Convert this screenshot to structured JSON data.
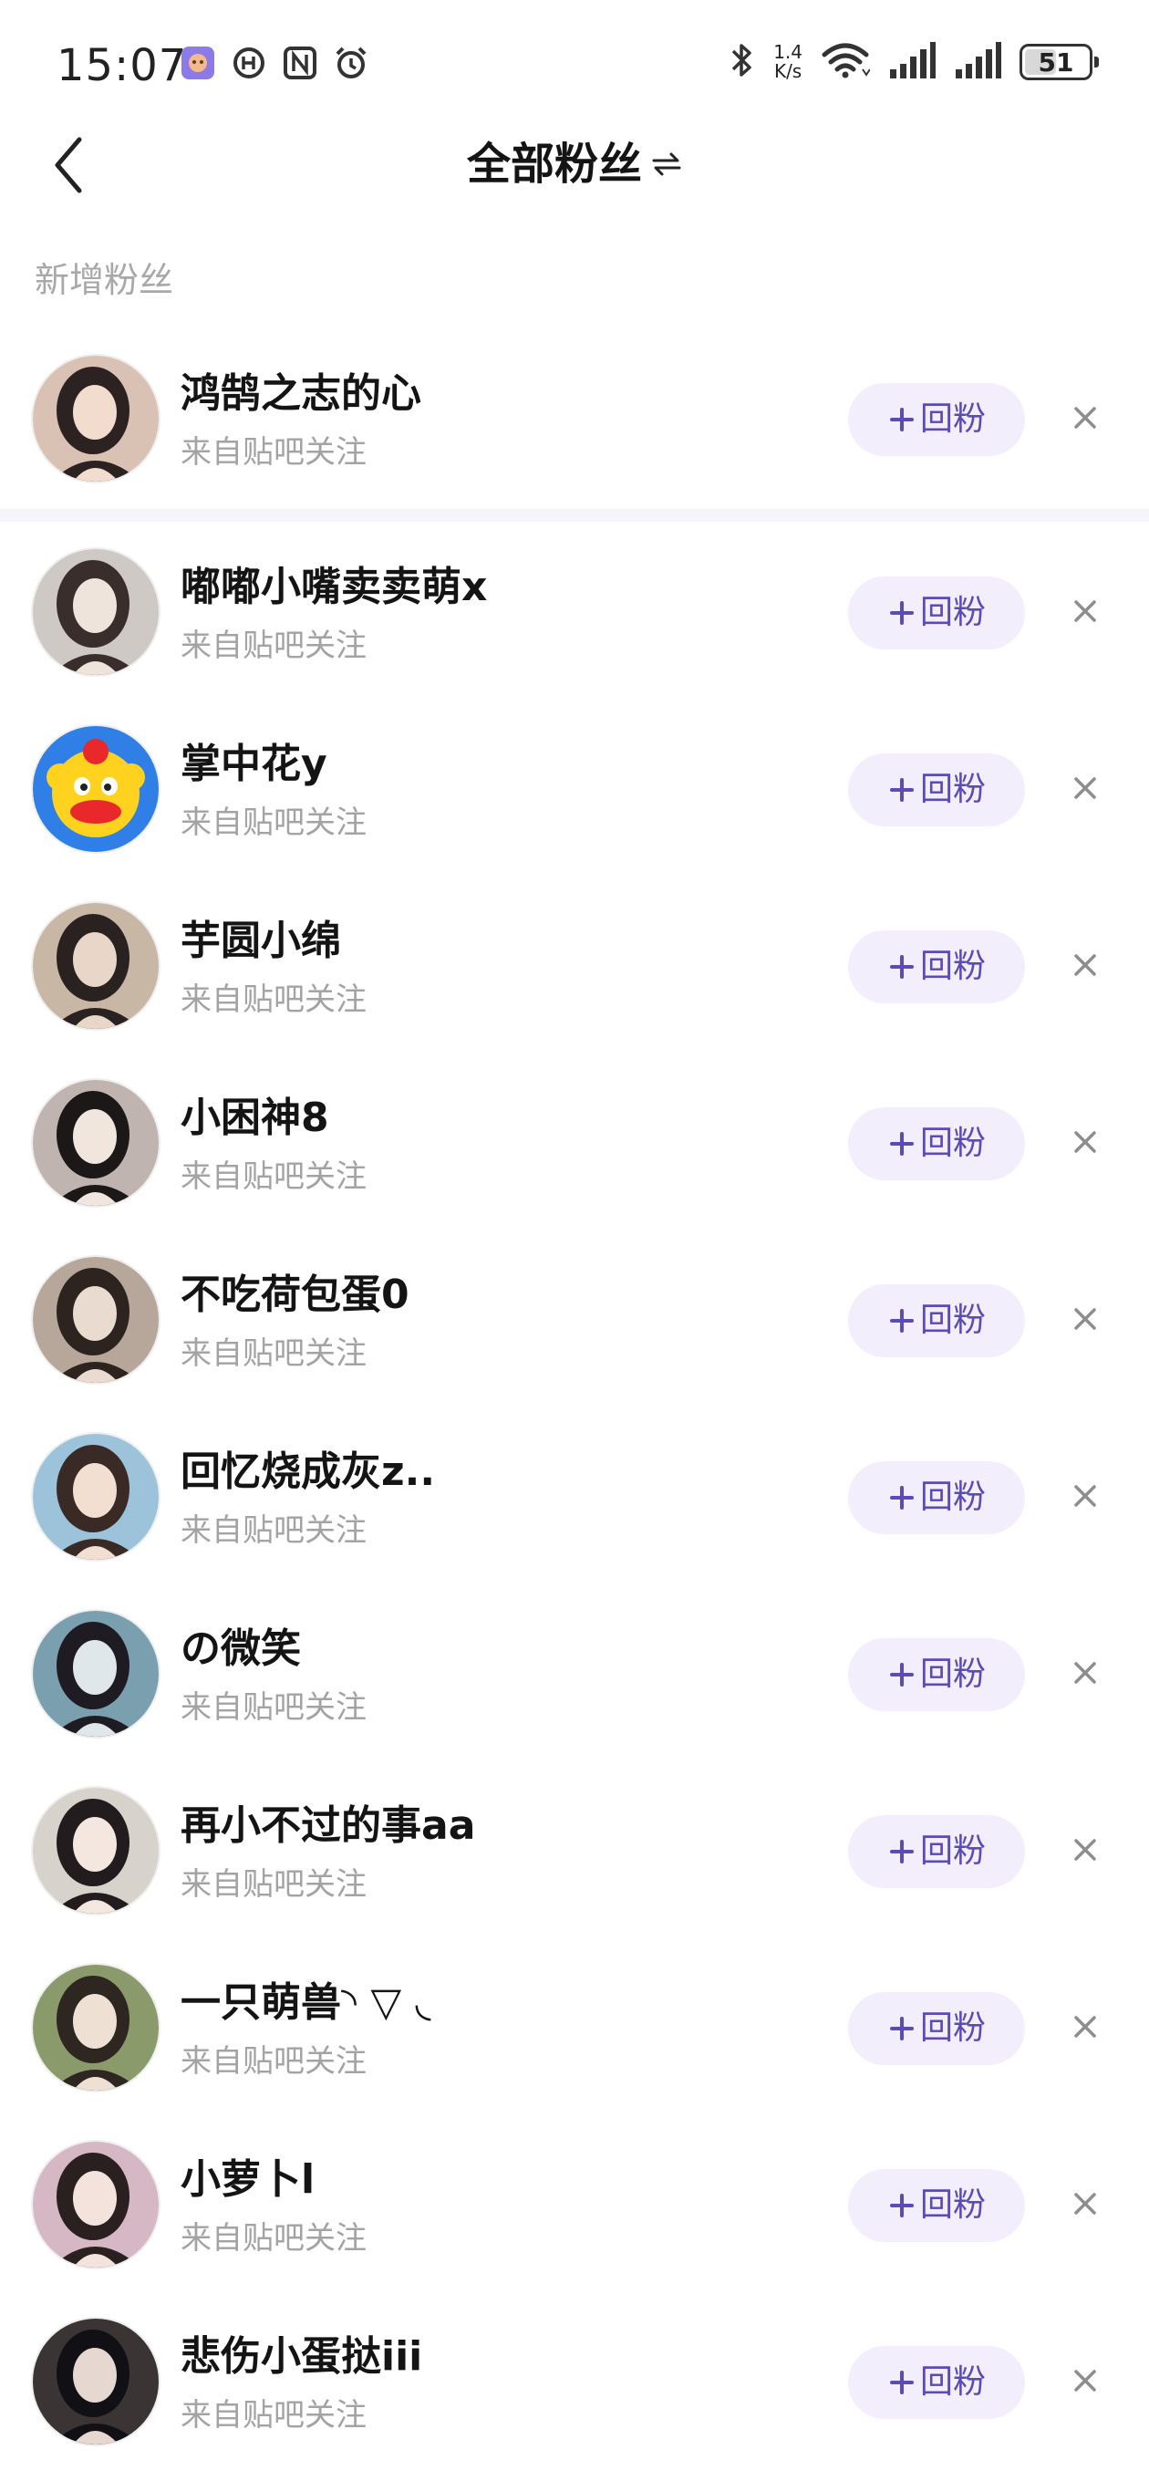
{
  "status_bar": {
    "time": "15:07",
    "net_speed_value": "1.4",
    "net_speed_unit": "K/s",
    "battery": "51",
    "left_icons": [
      "app-badge-icon",
      "sync-icon",
      "nfc-icon",
      "alarm-icon"
    ],
    "right_icons": [
      "bluetooth-icon",
      "wifi-icon",
      "signal-icon",
      "signal-icon"
    ]
  },
  "nav": {
    "title": "全部粉丝",
    "switch_icon": "switch-arrows-icon",
    "back_icon": "chevron-left-icon"
  },
  "section": {
    "new_fans_label": "新增粉丝"
  },
  "actions": {
    "follow_back_label": "回粉",
    "follow_back_icon": "plus-icon",
    "dismiss_icon": "close-icon"
  },
  "fans": [
    {
      "name": "鸿鹄之志的心",
      "source": "来自贴吧关注",
      "avatar": "photo-avatar"
    },
    {
      "name": "嘟嘟小嘴卖卖萌x",
      "source": "来自贴吧关注",
      "avatar": "photo-avatar"
    },
    {
      "name": "掌中花y",
      "source": "来自贴吧关注",
      "avatar": "cartoon-clown-avatar"
    },
    {
      "name": "芋圆小绵",
      "source": "来自贴吧关注",
      "avatar": "photo-avatar"
    },
    {
      "name": "小困神8",
      "source": "来自贴吧关注",
      "avatar": "photo-avatar"
    },
    {
      "name": "不吃荷包蛋0",
      "source": "来自贴吧关注",
      "avatar": "photo-avatar"
    },
    {
      "name": "回忆烧成灰z..",
      "source": "来自贴吧关注",
      "avatar": "photo-avatar"
    },
    {
      "name": "の微笑",
      "source": "来自贴吧关注",
      "avatar": "photo-avatar"
    },
    {
      "name": "再小不过的事aa",
      "source": "来自贴吧关注",
      "avatar": "photo-avatar"
    },
    {
      "name": "一只萌兽◝ ▽ ◟",
      "source": "来自贴吧关注",
      "avatar": "photo-avatar"
    },
    {
      "name": "小萝卜l",
      "source": "来自贴吧关注",
      "avatar": "photo-avatar"
    },
    {
      "name": "悲伤小蛋挞iii",
      "source": "来自贴吧关注",
      "avatar": "photo-avatar"
    }
  ],
  "colors": {
    "accent": "#5a4bb5",
    "button_bg": "#f3eefc",
    "secondary_text": "#a3a3a3",
    "divider": "#f6f4fb"
  }
}
